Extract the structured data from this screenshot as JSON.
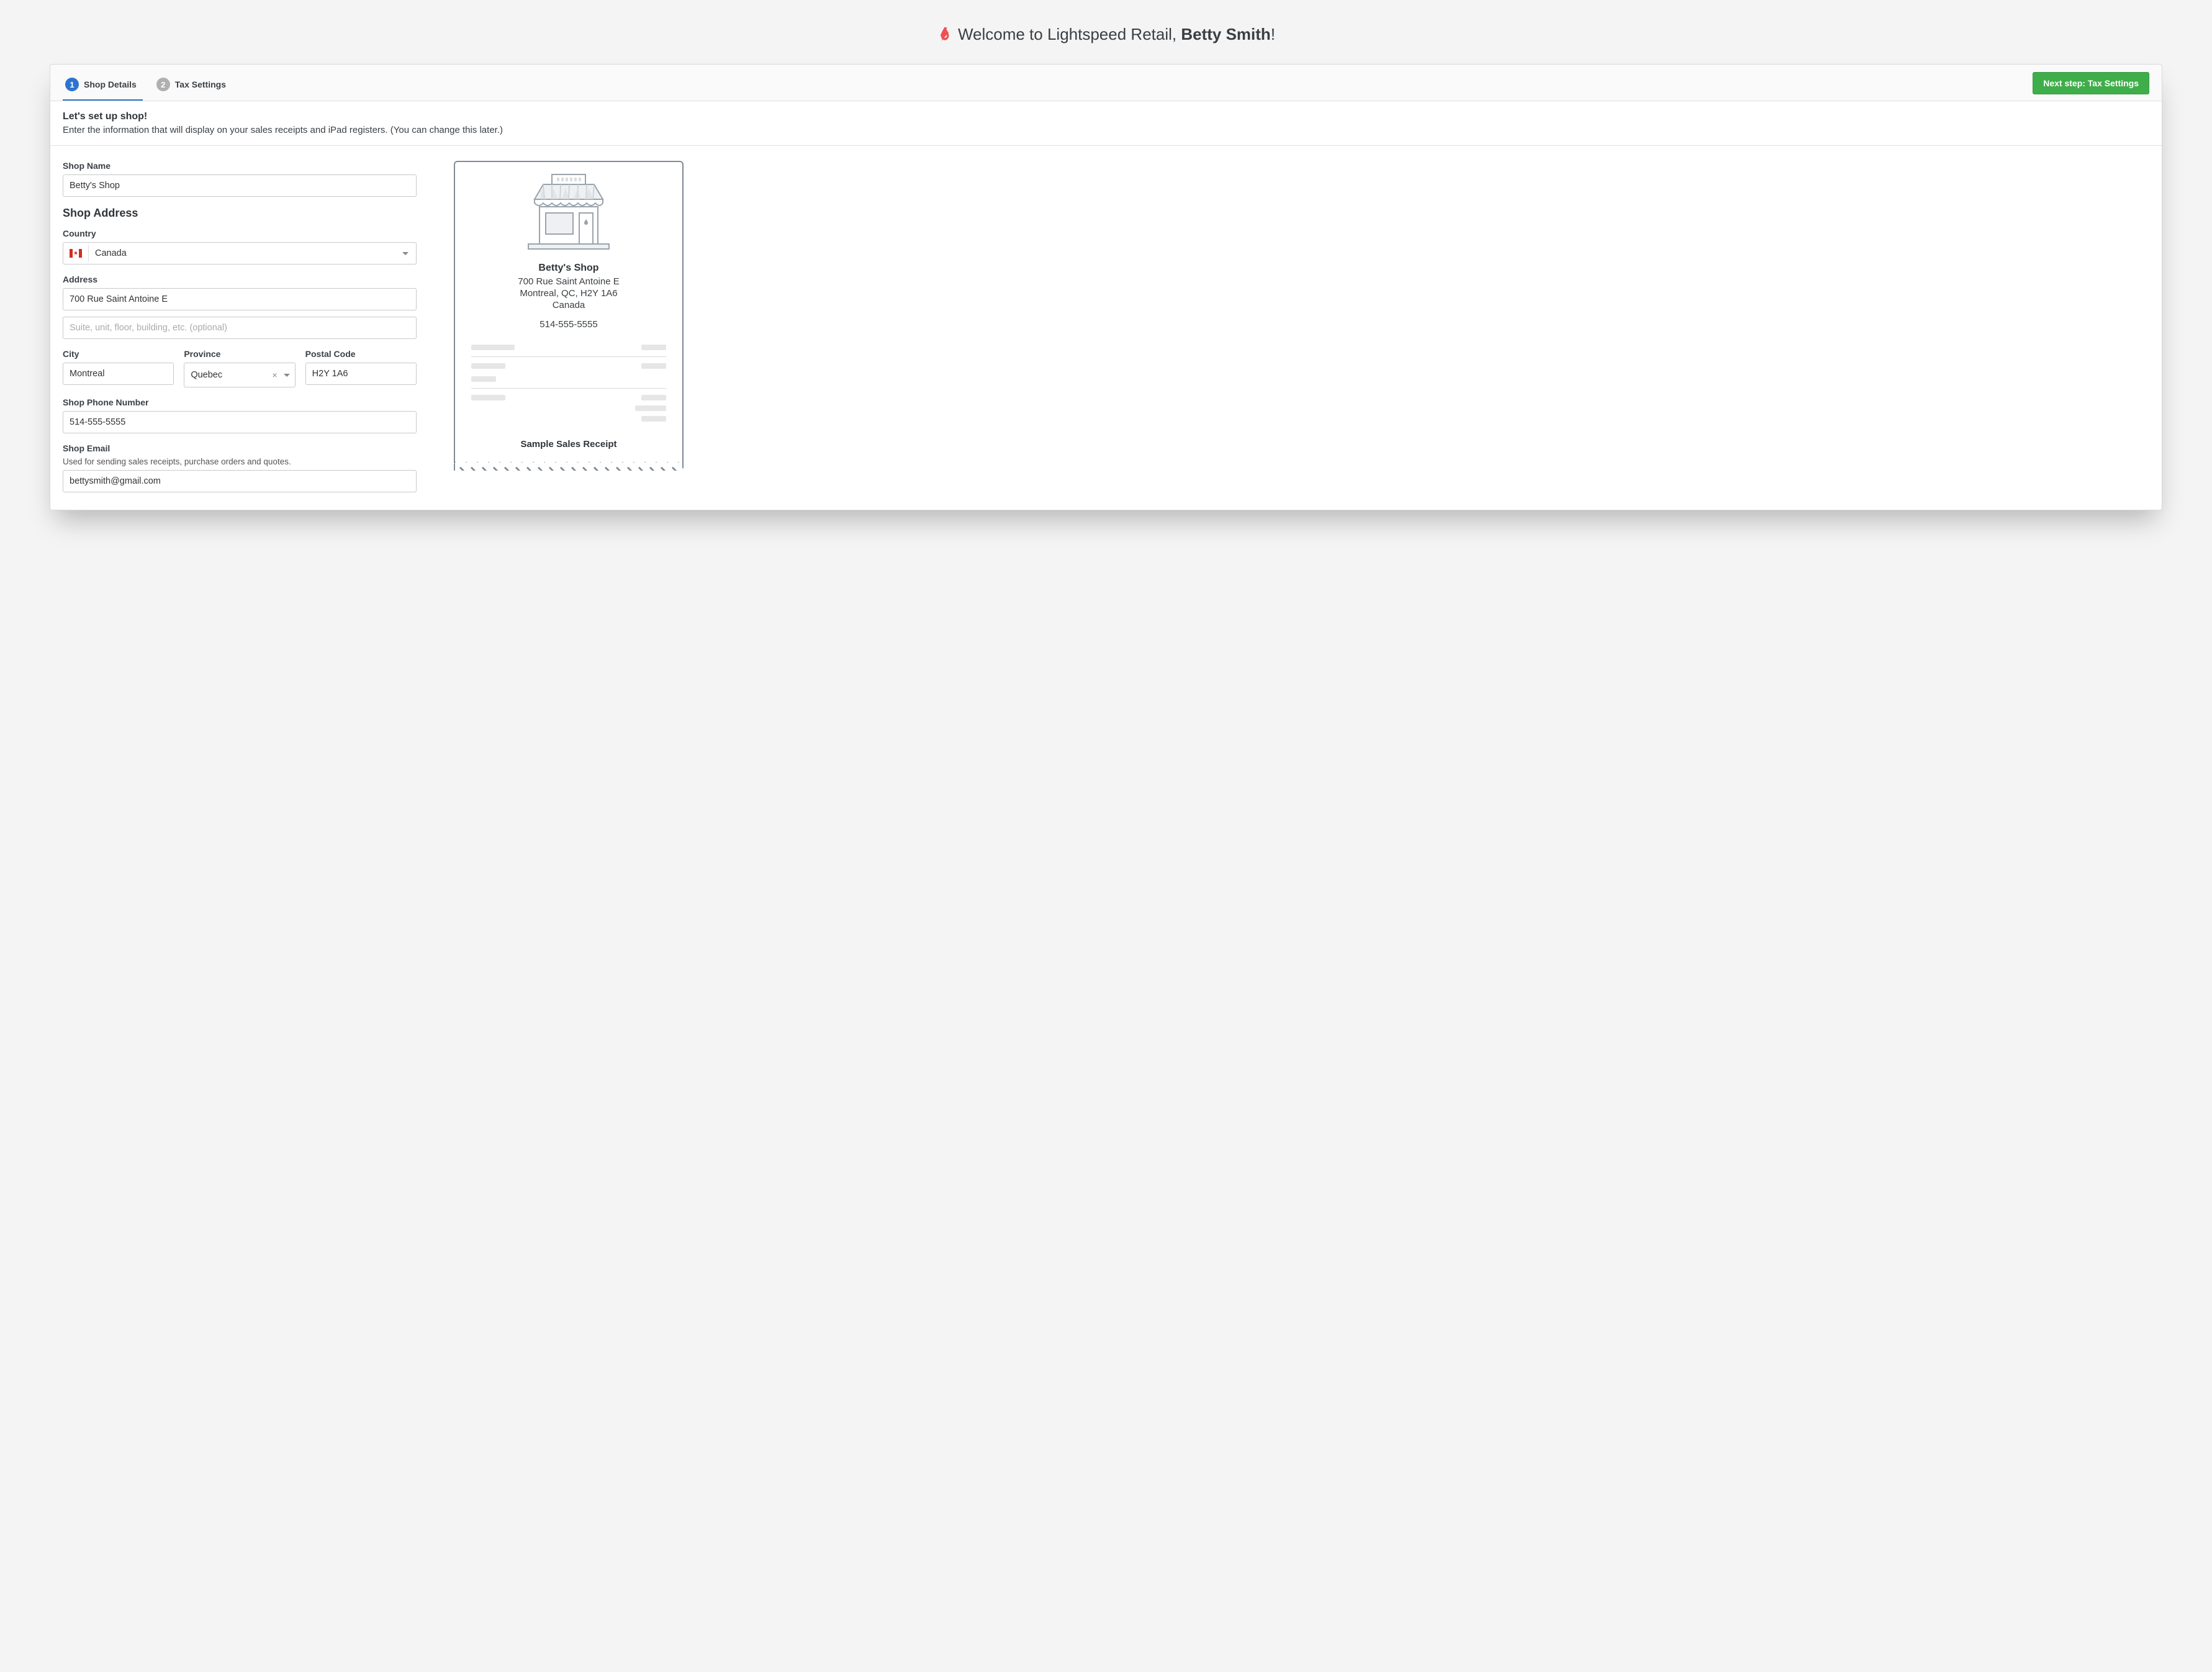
{
  "header": {
    "welcome_prefix": "Welcome to Lightspeed Retail, ",
    "welcome_name": "Betty Smith",
    "welcome_suffix": "!"
  },
  "stepper": {
    "steps": [
      {
        "num": "1",
        "label": "Shop Details"
      },
      {
        "num": "2",
        "label": "Tax Settings"
      }
    ],
    "next_button": "Next step: Tax Settings"
  },
  "intro": {
    "heading": "Let's set up shop!",
    "text": "Enter the information that will display on your sales receipts and iPad registers. (You can change this later.)"
  },
  "form": {
    "shop_name_label": "Shop Name",
    "shop_name_value": "Betty's Shop",
    "address_heading": "Shop Address",
    "country_label": "Country",
    "country_value": "Canada",
    "address_label": "Address",
    "address_value": "700 Rue Saint Antoine E",
    "address2_placeholder": "Suite, unit, floor, building, etc. (optional)",
    "city_label": "City",
    "city_value": "Montreal",
    "province_label": "Province",
    "province_value": "Quebec",
    "postal_label": "Postal Code",
    "postal_value": "H2Y 1A6",
    "phone_label": "Shop Phone Number",
    "phone_value": "514-555-5555",
    "email_label": "Shop Email",
    "email_sublabel": "Used for sending sales receipts, purchase orders and quotes.",
    "email_value": "bettysmith@gmail.com"
  },
  "receipt": {
    "shop_name": "Betty's Shop",
    "line1": "700 Rue Saint Antoine E",
    "line2": "Montreal, QC, H2Y 1A6",
    "line3": "Canada",
    "phone": "514-555-5555",
    "sample_label": "Sample Sales Receipt"
  }
}
